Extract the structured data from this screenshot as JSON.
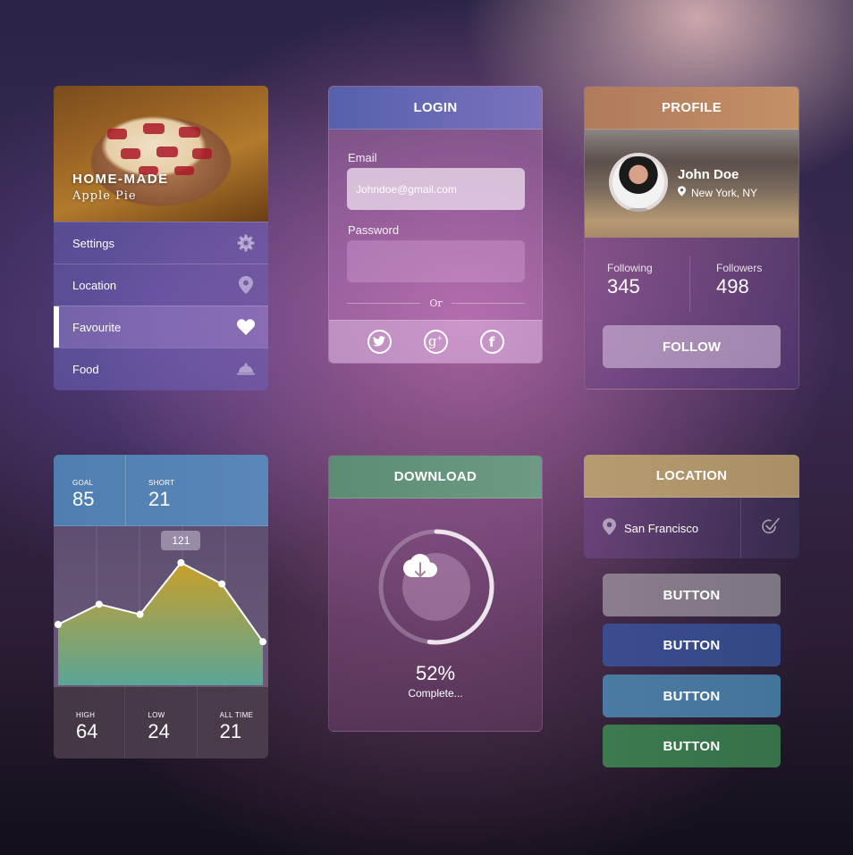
{
  "menu_card": {
    "hero": {
      "title": "HOME-MADE",
      "subtitle": "Apple Pie"
    },
    "items": [
      {
        "label": "Settings",
        "icon": "gear-icon",
        "active": false
      },
      {
        "label": "Location",
        "icon": "map-pin-icon",
        "active": false
      },
      {
        "label": "Favourite",
        "icon": "heart-icon",
        "active": true
      },
      {
        "label": "Food",
        "icon": "cloche-icon",
        "active": false
      }
    ]
  },
  "login_card": {
    "title": "LOGIN",
    "email_label": "Email",
    "email_placeholder": "Johndoe@gmail.com",
    "email_value": "",
    "password_label": "Password",
    "password_value": "",
    "divider_text": "Or",
    "social": [
      "twitter-icon",
      "google-plus-icon",
      "facebook-icon"
    ]
  },
  "profile_card": {
    "title": "PROFILE",
    "name": "John Doe",
    "location": "New York, NY",
    "stats": [
      {
        "label": "Following",
        "value": "345"
      },
      {
        "label": "Followers",
        "value": "498"
      }
    ],
    "follow_label": "FOLLOW"
  },
  "chart_card": {
    "top_stats": [
      {
        "label": "GOAL",
        "value": "85"
      },
      {
        "label": "SHORT",
        "value": "21"
      }
    ],
    "bottom_stats": [
      {
        "label": "HIGH",
        "value": "64"
      },
      {
        "label": "LOW",
        "value": "24"
      },
      {
        "label": "ALL TIME",
        "value": "21"
      }
    ],
    "tooltip": "121"
  },
  "chart_data": {
    "type": "area",
    "x": [
      0,
      1,
      2,
      3,
      4,
      5
    ],
    "values": [
      60,
      80,
      70,
      121,
      100,
      43
    ],
    "highlight_index": 3,
    "highlight_label": "121",
    "ylim": [
      0,
      150
    ],
    "grid": true,
    "title": "",
    "xlabel": "",
    "ylabel": "",
    "colors": {
      "top": "#c9a02a",
      "bottom": "#5aa596",
      "line": "#ffffff"
    }
  },
  "download_card": {
    "title": "DOWNLOAD",
    "progress": 52,
    "percent_text": "52%",
    "status": "Complete..."
  },
  "location_card": {
    "title": "LOCATION",
    "city": "San Francisco"
  },
  "buttons": [
    {
      "label": "BUTTON",
      "color": "#857a87"
    },
    {
      "label": "BUTTON",
      "color": "#374a8a"
    },
    {
      "label": "BUTTON",
      "color": "#47779f"
    },
    {
      "label": "BUTTON",
      "color": "#3a764c"
    }
  ]
}
